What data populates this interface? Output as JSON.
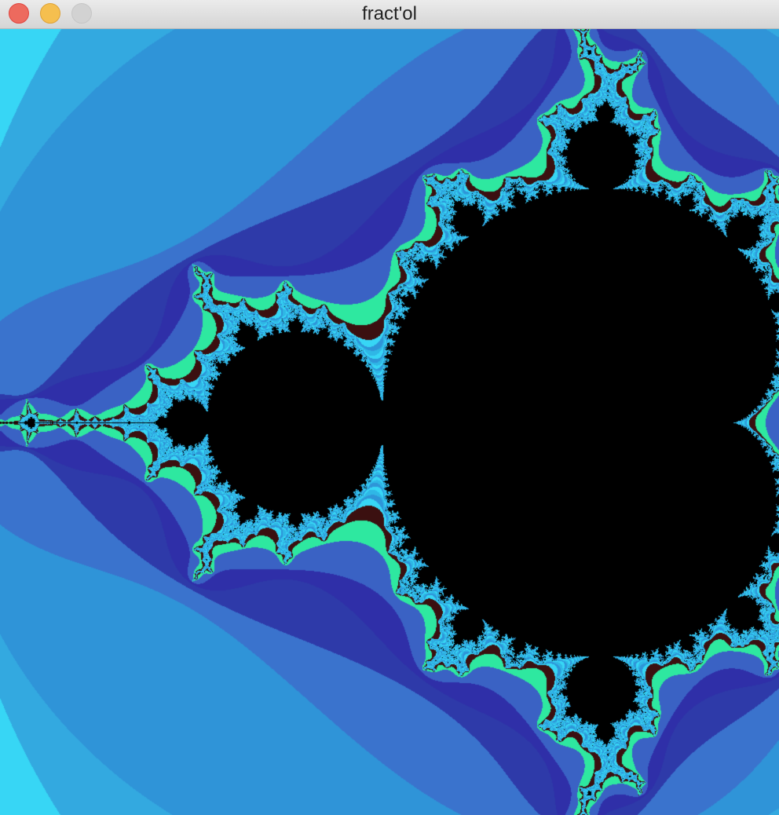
{
  "window": {
    "title": "fract'ol",
    "buttons": {
      "close_color": "#ed6a5e",
      "minimize_color": "#f5bf4f",
      "zoom_color": "#d2d2d2"
    }
  },
  "fractal": {
    "palette": [
      "#000000",
      "#3b1010",
      "#2ee8a0",
      "#2fb7e6",
      "#37d6f5",
      "#2e95d8",
      "#3b84cf",
      "#3a62c4",
      "#2f2fa8",
      "#2e3aa9",
      "#3a73cd",
      "#2f94d8",
      "#33a9e0",
      "#35c5ec"
    ],
    "inside_color": "#000000"
  }
}
